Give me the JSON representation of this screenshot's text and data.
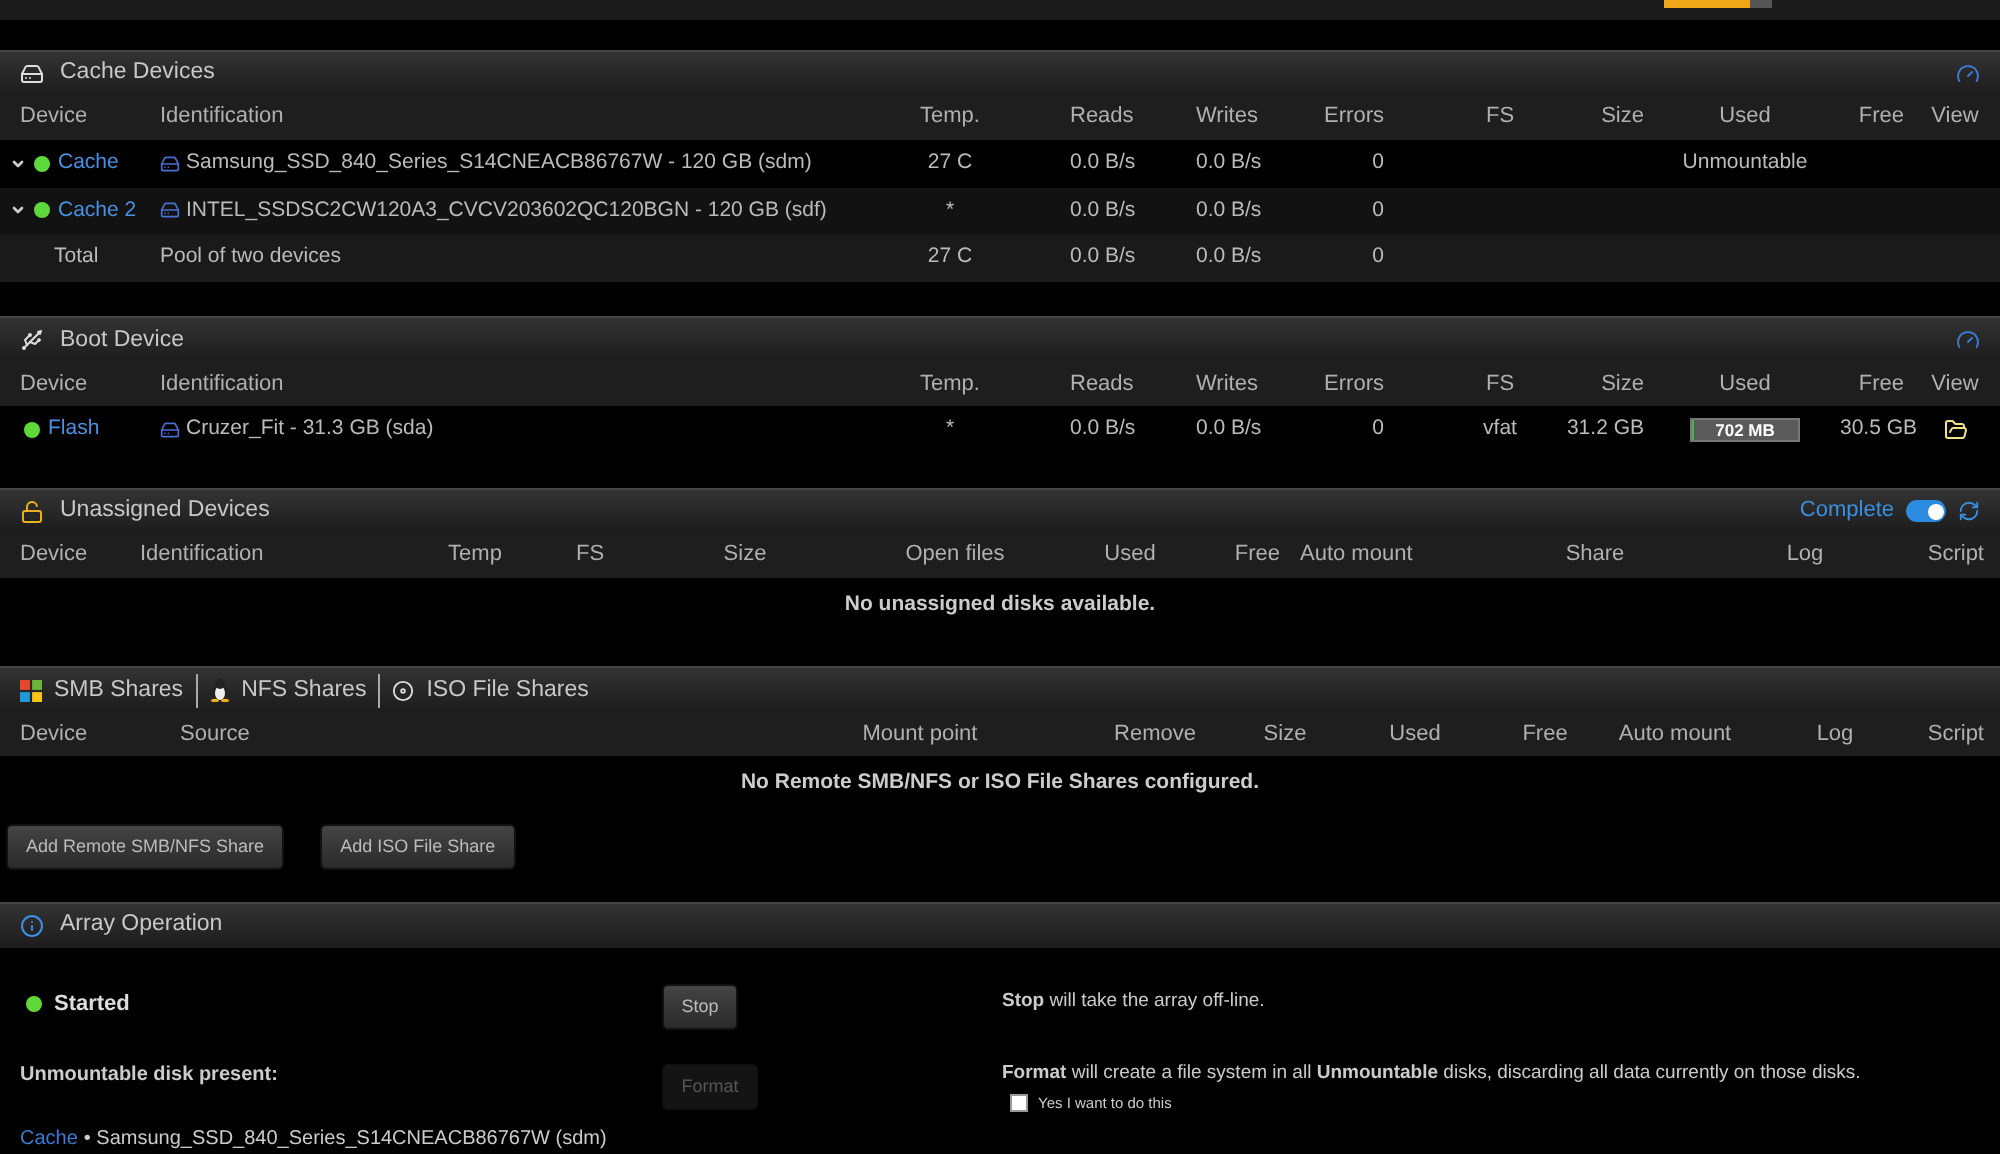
{
  "top_bar": {
    "meter": {
      "level": 0.8
    }
  },
  "cache_devices": {
    "title": "Cache Devices",
    "columns": [
      "Device",
      "Identification",
      "Temp.",
      "Reads",
      "Writes",
      "Errors",
      "FS",
      "Size",
      "Used",
      "Free",
      "View"
    ],
    "rows": [
      {
        "device": "Cache",
        "online": true,
        "identification": "Samsung_SSD_840_Series_S14CNEACB86767W - 120 GB (sdm)",
        "temp": "27 C",
        "reads": "0.0 B/s",
        "writes": "0.0 B/s",
        "errors": "0",
        "used": "Unmountable"
      },
      {
        "device": "Cache 2",
        "online": true,
        "identification": "INTEL_SSDSC2CW120A3_CVCV203602QC120BGN - 120 GB (sdf)",
        "temp": "*",
        "reads": "0.0 B/s",
        "writes": "0.0 B/s",
        "errors": "0"
      }
    ],
    "total": {
      "label": "Total",
      "identification": "Pool of two devices",
      "temp": "27 C",
      "reads": "0.0 B/s",
      "writes": "0.0 B/s",
      "errors": "0"
    }
  },
  "boot_device": {
    "title": "Boot Device",
    "columns": [
      "Device",
      "Identification",
      "Temp.",
      "Reads",
      "Writes",
      "Errors",
      "FS",
      "Size",
      "Used",
      "Free",
      "View"
    ],
    "rows": [
      {
        "device": "Flash",
        "online": true,
        "identification": "Cruzer_Fit - 31.3 GB (sda)",
        "temp": "*",
        "reads": "0.0 B/s",
        "writes": "0.0 B/s",
        "errors": "0",
        "fs": "vfat",
        "size": "31.2 GB",
        "usage": {
          "label": "702 MB",
          "level": 0.02
        },
        "free": "30.5 GB"
      }
    ]
  },
  "unassigned_devices": {
    "title": "Unassigned Devices",
    "link": "Complete",
    "toggle": {
      "on": true
    },
    "columns": [
      "Device",
      "Identification",
      "Temp",
      "FS",
      "Size",
      "Open files",
      "Used",
      "Free",
      "Auto mount",
      "Share",
      "Log",
      "Script"
    ],
    "message": "No unassigned disks available."
  },
  "remote_shares": {
    "tabs": [
      "SMB Shares",
      "NFS Shares",
      "ISO File Shares"
    ],
    "columns": [
      "Device",
      "Source",
      "Mount point",
      "Remove",
      "Size",
      "Used",
      "Free",
      "Auto mount",
      "Log",
      "Script"
    ],
    "message": "No Remote SMB/NFS or ISO File Shares configured.",
    "buttons": [
      "Add Remote SMB/NFS Share",
      "Add ISO File Share"
    ]
  },
  "array_operation": {
    "title": "Array Operation",
    "status": {
      "label": "Started",
      "online": true
    },
    "stop_button": {
      "label": "Stop",
      "disabled": false
    },
    "stop_text": "**Stop** will take the array off-line.",
    "unmountable_label": "Unmountable disk present:",
    "disk_link": "Cache",
    "disk_text": "• Samsung_SSD_840_Series_S14CNEACB86767W (sdm)",
    "format_button": {
      "label": "Format",
      "disabled": true
    },
    "format_text": "**Format** will create a file system in all **Unmountable** disks, discarding all data currently on those disks.",
    "confirm": {
      "label": "Yes I want to do this",
      "checked": false
    }
  }
}
